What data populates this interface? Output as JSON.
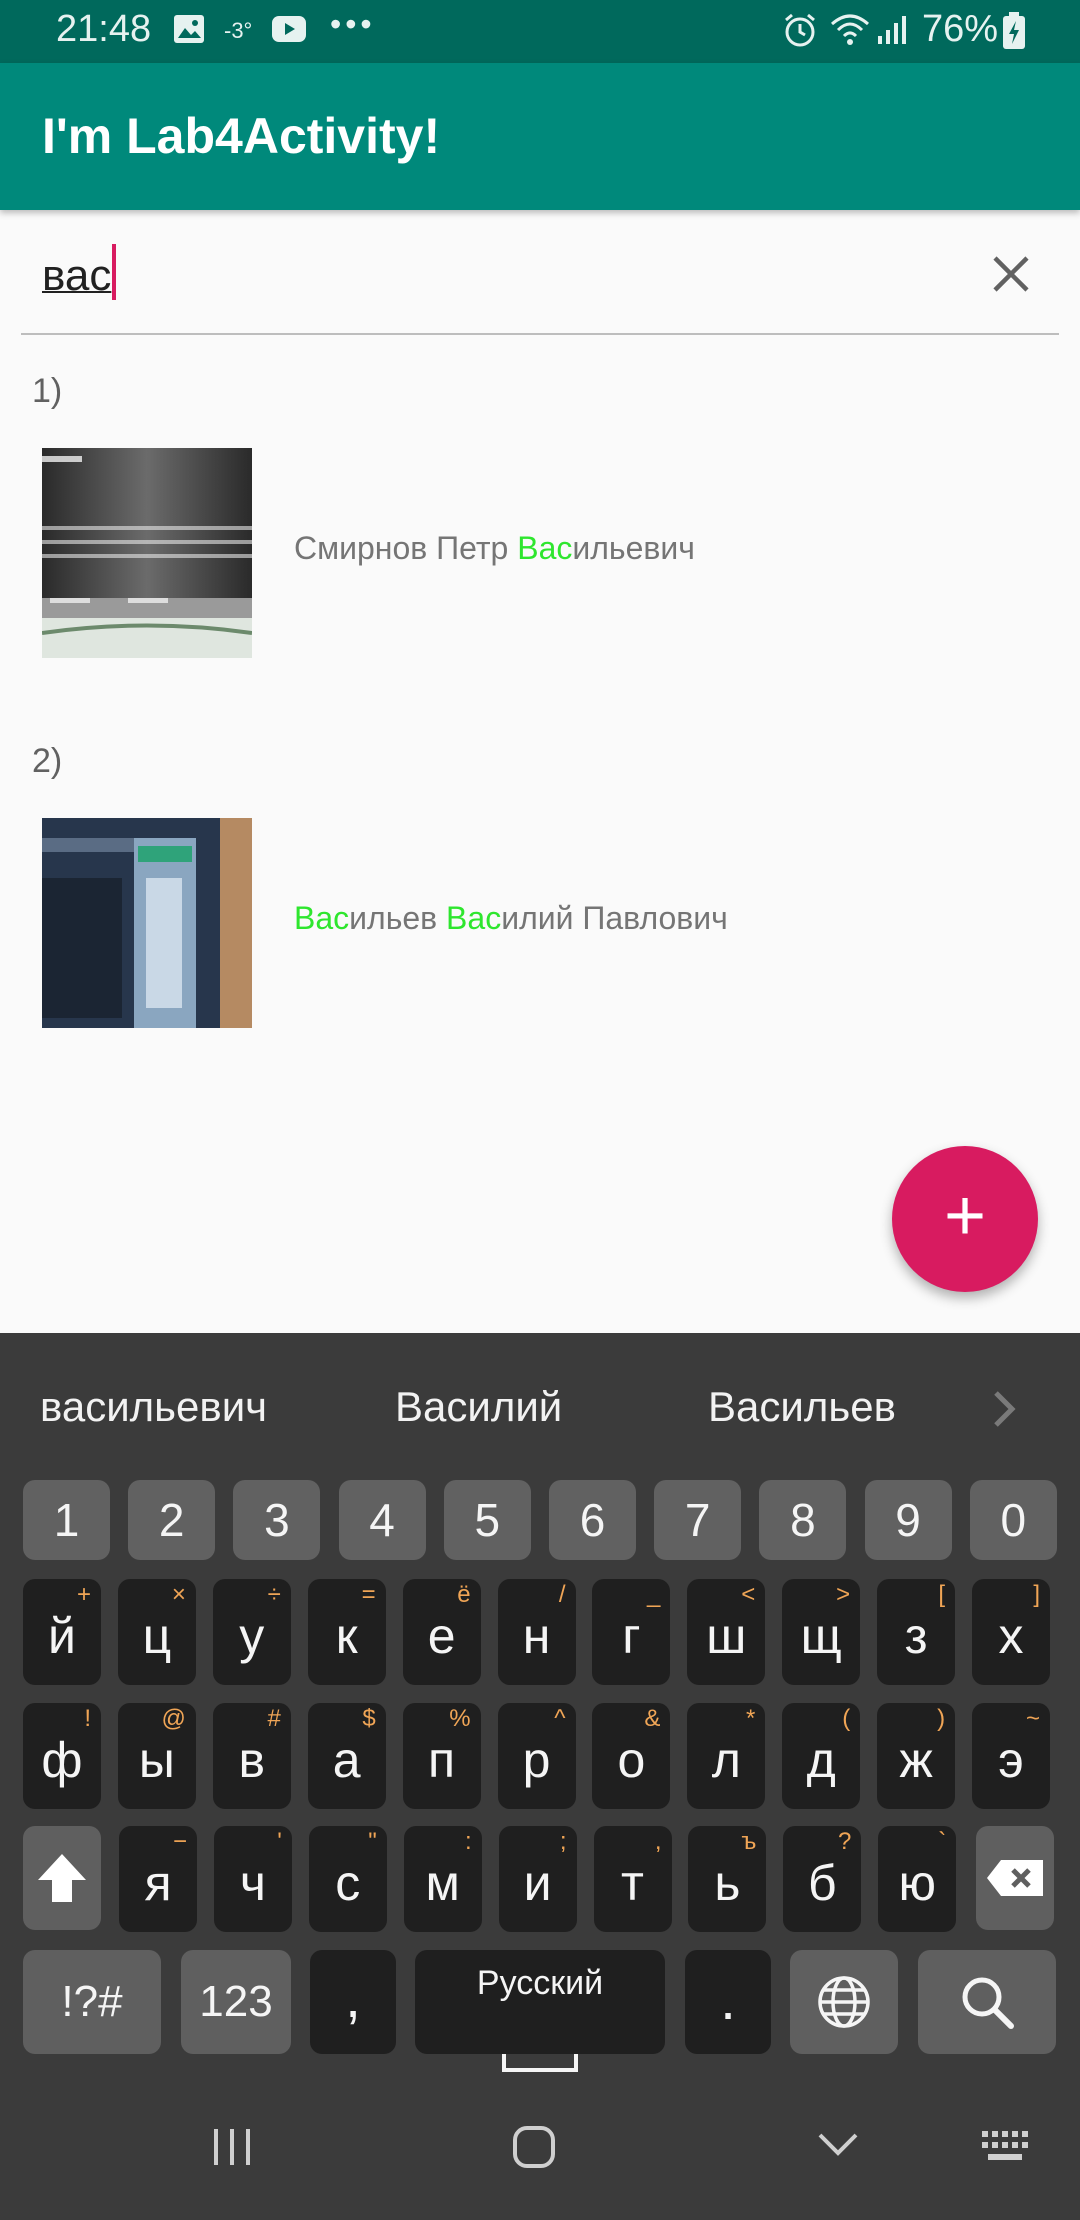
{
  "status_bar": {
    "time": "21:48",
    "temperature": "-3°",
    "dots": "•••",
    "battery": "76%"
  },
  "app_bar": {
    "title": "I'm Lab4Activity!"
  },
  "search": {
    "value": "вас"
  },
  "list": {
    "items": [
      {
        "index": "1)",
        "name_parts": [
          "Смирнов Петр ",
          "Вас",
          "ильевич"
        ]
      },
      {
        "index": "2)",
        "name_parts": [
          "Вас",
          "ильев ",
          "Вас",
          "илий Павлович"
        ]
      }
    ]
  },
  "fab": {
    "label": "+"
  },
  "keyboard": {
    "suggestions": [
      "васильевич",
      "Василий",
      "Васильев"
    ],
    "numbers": [
      "1",
      "2",
      "3",
      "4",
      "5",
      "6",
      "7",
      "8",
      "9",
      "0"
    ],
    "row1": [
      [
        "й",
        "+"
      ],
      [
        "ц",
        "×"
      ],
      [
        "у",
        "÷"
      ],
      [
        "к",
        "="
      ],
      [
        "е",
        "ё"
      ],
      [
        "н",
        "/"
      ],
      [
        "г",
        "_"
      ],
      [
        "ш",
        "<"
      ],
      [
        "щ",
        ">"
      ],
      [
        "з",
        "["
      ],
      [
        "х",
        "]"
      ]
    ],
    "row2": [
      [
        "ф",
        "!"
      ],
      [
        "ы",
        "@"
      ],
      [
        "в",
        "#"
      ],
      [
        "а",
        "$"
      ],
      [
        "п",
        "%"
      ],
      [
        "р",
        "^"
      ],
      [
        "о",
        "&"
      ],
      [
        "л",
        "*"
      ],
      [
        "д",
        "("
      ],
      [
        "ж",
        ")"
      ],
      [
        "э",
        "~"
      ]
    ],
    "row3": [
      [
        "я",
        "−"
      ],
      [
        "ч",
        "'"
      ],
      [
        "с",
        "\""
      ],
      [
        "м",
        ":"
      ],
      [
        "и",
        ";"
      ],
      [
        "т",
        ","
      ],
      [
        "ь",
        "ъ"
      ],
      [
        "б",
        "?"
      ],
      [
        "ю",
        "`"
      ]
    ],
    "symbols_label": "!?#",
    "numbers_label": "123",
    "comma": ",",
    "space_label": "Русский",
    "period": "."
  },
  "colors": {
    "status_bar": "#00695c",
    "app_bar": "#00897b",
    "accent": "#d81b60",
    "highlight": "#2ee62e",
    "keyboard_bg": "#3b3b3b"
  }
}
